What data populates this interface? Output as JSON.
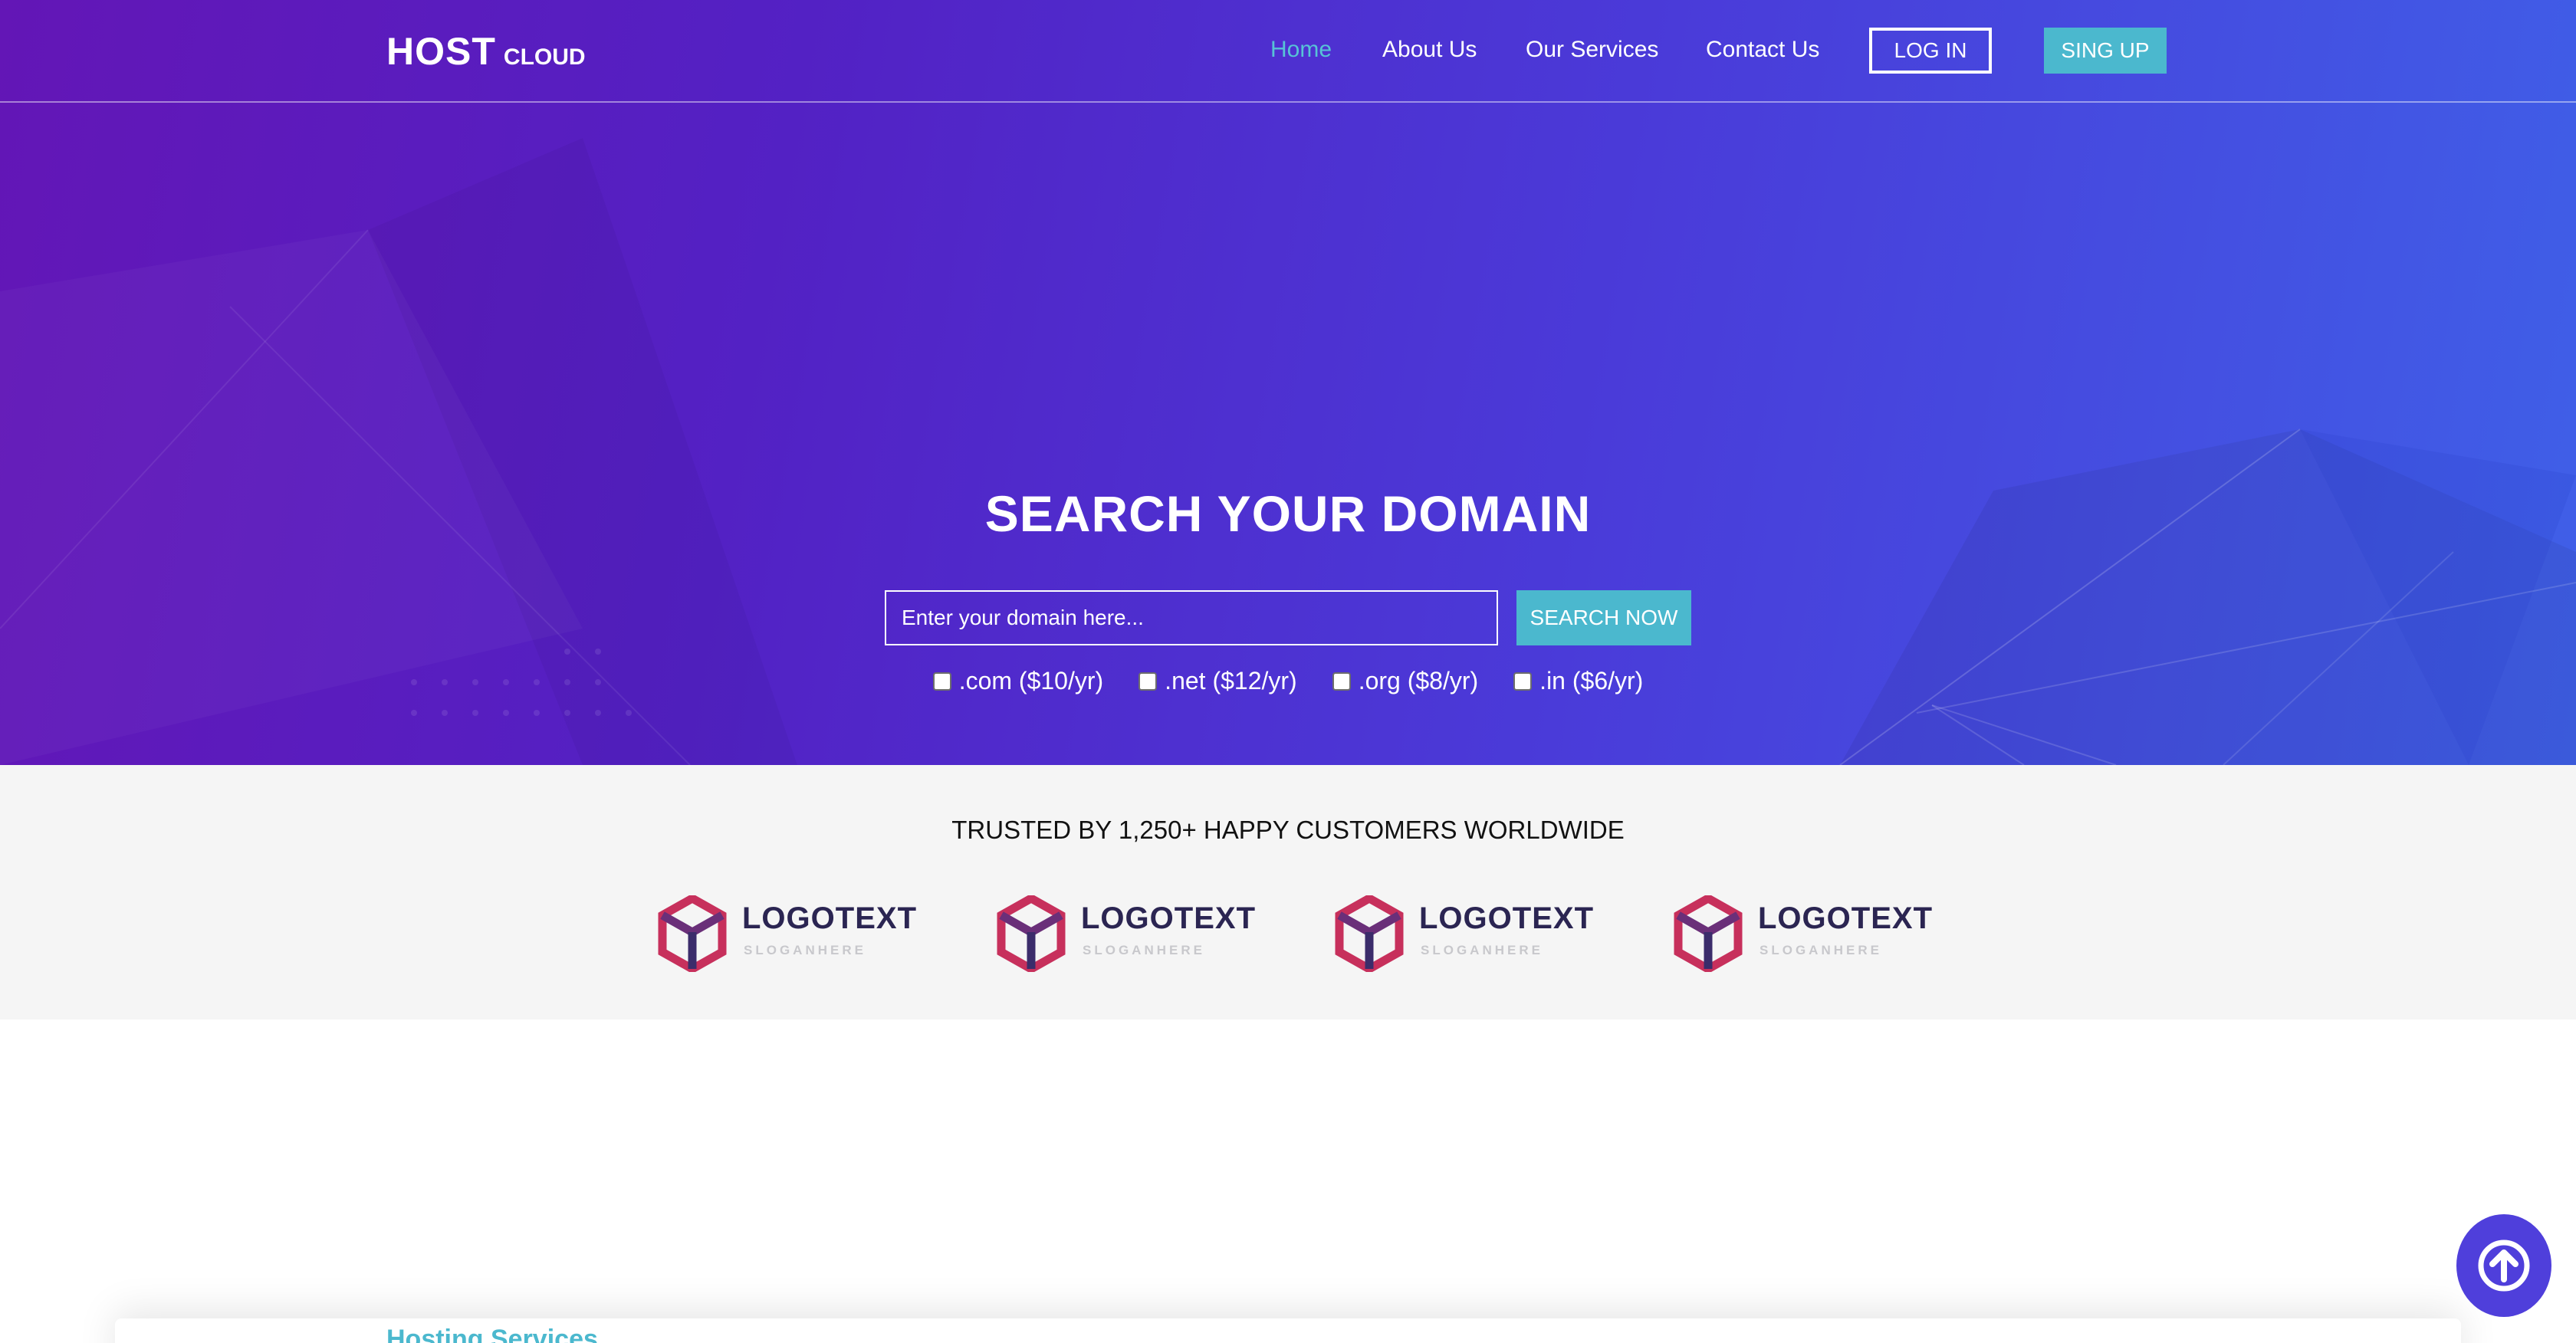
{
  "brand": {
    "main": "HOST",
    "sub": "CLOUD"
  },
  "nav": {
    "links": [
      "Home",
      "About Us",
      "Our Services",
      "Contact Us"
    ],
    "login": "LOG IN",
    "signup": "SING UP"
  },
  "hero": {
    "title": "SEARCH YOUR DOMAIN",
    "search_placeholder": "Enter your domain here...",
    "search_button": "SEARCH NOW",
    "tlds": [
      ".com ($10/yr)",
      ".net ($12/yr)",
      ".org ($8/yr)",
      ".in ($6/yr)"
    ]
  },
  "trusted": {
    "title": "TRUSTED BY 1,250+ HAPPY CUSTOMERS WORLDWIDE",
    "logos": [
      {
        "text": "LOGOTEXT",
        "slogan": "SLOGANHERE"
      },
      {
        "text": "LOGOTEXT",
        "slogan": "SLOGANHERE"
      },
      {
        "text": "LOGOTEXT",
        "slogan": "SLOGANHERE"
      },
      {
        "text": "LOGOTEXT",
        "slogan": "SLOGANHERE"
      }
    ]
  },
  "services": {
    "title": "Hosting Services"
  },
  "colors": {
    "accent": "#4bb8ce",
    "hero_start": "#6316b6",
    "hero_end": "#3f60e8",
    "scroll_button": "#4f3fdb"
  },
  "icons": {
    "scroll_top": "arrow-up-circle-icon",
    "logo_mark": "hexagon-cube-icon"
  }
}
